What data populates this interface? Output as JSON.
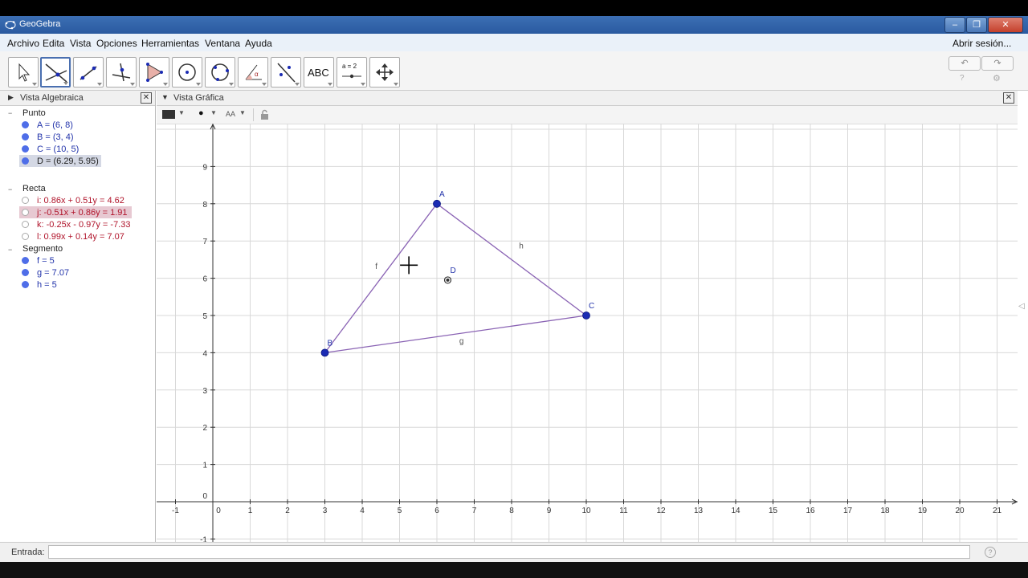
{
  "window": {
    "title": "GeoGebra"
  },
  "menu": {
    "items": [
      "Archivo",
      "Edita",
      "Vista",
      "Opciones",
      "Herramientas",
      "Ventana",
      "Ayuda"
    ],
    "login": "Abrir sesión..."
  },
  "toolbar": {
    "tools": [
      "move-tool",
      "intersect-tool",
      "line-tool",
      "perpendicular-tool",
      "polygon-tool",
      "circle-tool",
      "conic-tool",
      "angle-tool",
      "reflect-tool",
      "text-tool",
      "slider-tool",
      "move-view-tool"
    ],
    "text_tool_label": "ABC",
    "slider_tool_label": "a = 2",
    "selected": "intersect-tool",
    "undo_icon": "undo-icon",
    "redo_icon": "redo-icon"
  },
  "algebra": {
    "title": "Vista Algebraica",
    "categories": {
      "punto": "Punto",
      "recta": "Recta",
      "segmento": "Segmento"
    },
    "points": [
      "A = (6, 8)",
      "B = (3, 4)",
      "C = (10, 5)",
      "D = (6.29, 5.95)"
    ],
    "lines": [
      "i: 0.86x + 0.51y = 4.62",
      "j: -0.51x + 0.86y = 1.91",
      "k: -0.25x - 0.97y = -7.33",
      "l: 0.99x + 0.14y = 7.07"
    ],
    "segments": [
      "f = 5",
      "g = 7.07",
      "h = 5"
    ]
  },
  "graphics": {
    "title": "Vista Gráfica",
    "font_size_label": "AA",
    "xlim": [
      -1,
      21
    ],
    "ylim": [
      -1,
      9
    ],
    "xticks": [
      "-1",
      "0",
      "1",
      "2",
      "3",
      "4",
      "5",
      "6",
      "7",
      "8",
      "9",
      "10",
      "11",
      "12",
      "13",
      "14",
      "15",
      "16",
      "17",
      "18",
      "19",
      "20",
      "21"
    ],
    "yticks": [
      "-1",
      "0",
      "1",
      "2",
      "3",
      "4",
      "5",
      "6",
      "7",
      "8",
      "9"
    ],
    "points": [
      {
        "name": "A",
        "x": 6,
        "y": 8
      },
      {
        "name": "B",
        "x": 3,
        "y": 4
      },
      {
        "name": "C",
        "x": 10,
        "y": 5
      },
      {
        "name": "D",
        "x": 6.29,
        "y": 5.95
      }
    ],
    "segment_labels": [
      {
        "name": "f",
        "x": 4.35,
        "y": 6.25
      },
      {
        "name": "g",
        "x": 6.6,
        "y": 4.25
      },
      {
        "name": "h",
        "x": 8.2,
        "y": 6.8
      }
    ],
    "segment_color": "#8a63b4",
    "point_color": "#1b2bb3"
  },
  "input": {
    "label": "Entrada:",
    "value": ""
  }
}
